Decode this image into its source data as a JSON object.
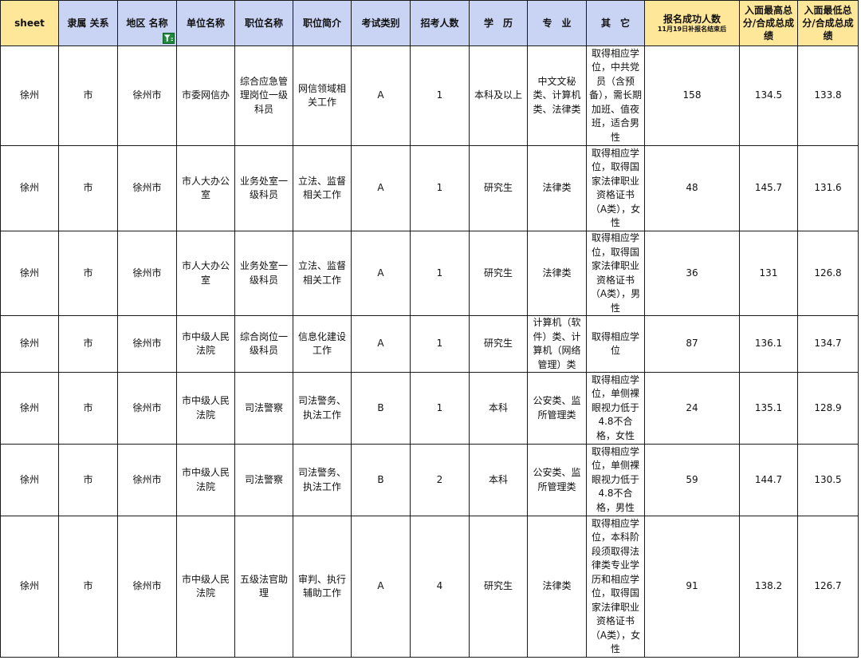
{
  "headers": {
    "sheet": "sheet",
    "affiliation": "隶属 关系",
    "region": "地区 名称",
    "unit": "单位名称",
    "position": "职位名称",
    "intro": "职位简介",
    "exam_type": "考试类别",
    "recruit_count": "招考人数",
    "education": "学　历",
    "major": "专　业",
    "other": "其　它",
    "applicants": "报名成功人数",
    "applicants_note": "11月19日补报名结束后",
    "max_score": "入面最高总分/合成总成绩",
    "min_score": "入面最低总分/合成总成绩"
  },
  "filter_icon": "filter-icon",
  "colors": {
    "header_blue": "#c9d4f4",
    "header_yellow": "#ffe79a",
    "filter_green": "#1e8a3c"
  },
  "rows": [
    {
      "sheet": "徐州",
      "affiliation": "市",
      "region": "徐州市",
      "unit": "市委网信办",
      "position": "综合应急管理岗位一级科员",
      "intro": "网信领域相关工作",
      "exam_type": "A",
      "recruit_count": "1",
      "education": "本科及以上",
      "major": "中文文秘类、计算机类、法律类",
      "other": "取得相应学位，中共党员（含预备），需长期加班、值夜班，适合男性",
      "applicants": "158",
      "max_score": "134.5",
      "min_score": "133.8"
    },
    {
      "sheet": "徐州",
      "affiliation": "市",
      "region": "徐州市",
      "unit": "市人大办公室",
      "position": "业务处室一级科员",
      "intro": "立法、监督相关工作",
      "exam_type": "A",
      "recruit_count": "1",
      "education": "研究生",
      "major": "法律类",
      "other": "取得相应学位，取得国家法律职业资格证书（A类），女性",
      "applicants": "48",
      "max_score": "145.7",
      "min_score": "131.6"
    },
    {
      "sheet": "徐州",
      "affiliation": "市",
      "region": "徐州市",
      "unit": "市人大办公室",
      "position": "业务处室一级科员",
      "intro": "立法、监督相关工作",
      "exam_type": "A",
      "recruit_count": "1",
      "education": "研究生",
      "major": "法律类",
      "other": "取得相应学位，取得国家法律职业资格证书（A类），男性",
      "applicants": "36",
      "max_score": "131",
      "min_score": "126.8"
    },
    {
      "sheet": "徐州",
      "affiliation": "市",
      "region": "徐州市",
      "unit": "市中级人民法院",
      "position": "综合岗位一级科员",
      "intro": "信息化建设工作",
      "exam_type": "A",
      "recruit_count": "1",
      "education": "研究生",
      "major": "计算机（软件）类、计算机（网络管理）类",
      "other": "取得相应学位",
      "applicants": "87",
      "max_score": "136.1",
      "min_score": "134.7"
    },
    {
      "sheet": "徐州",
      "affiliation": "市",
      "region": "徐州市",
      "unit": "市中级人民法院",
      "position": "司法警察",
      "intro": "司法警务、执法工作",
      "exam_type": "B",
      "recruit_count": "1",
      "education": "本科",
      "major": "公安类、监所管理类",
      "other": "取得相应学位，单侧裸眼视力低于4.8不合格，女性",
      "applicants": "24",
      "max_score": "135.1",
      "min_score": "128.9"
    },
    {
      "sheet": "徐州",
      "affiliation": "市",
      "region": "徐州市",
      "unit": "市中级人民法院",
      "position": "司法警察",
      "intro": "司法警务、执法工作",
      "exam_type": "B",
      "recruit_count": "2",
      "education": "本科",
      "major": "公安类、监所管理类",
      "other": "取得相应学位，单侧裸眼视力低于4.8不合格，男性",
      "applicants": "59",
      "max_score": "144.7",
      "min_score": "130.5"
    },
    {
      "sheet": "徐州",
      "affiliation": "市",
      "region": "徐州市",
      "unit": "市中级人民法院",
      "position": "五级法官助理",
      "intro": "审判、执行辅助工作",
      "exam_type": "A",
      "recruit_count": "4",
      "education": "研究生",
      "major": "法律类",
      "other": "取得相应学位，本科阶段须取得法律类专业学历和相应学位，取得国家法律职业资格证书（A类），女性",
      "applicants": "91",
      "max_score": "138.2",
      "min_score": "126.7"
    }
  ]
}
